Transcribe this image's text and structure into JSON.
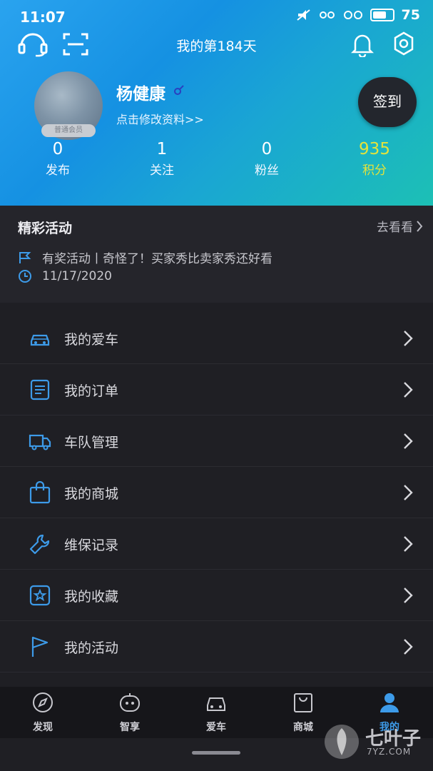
{
  "status_bar": {
    "time": "11:07",
    "battery": "75"
  },
  "header": {
    "title": "我的第184天",
    "user_name": "杨健康",
    "edit_profile": "点击修改资料>>",
    "member_badge": "普通会员",
    "checkin_label": "签到"
  },
  "stats": [
    {
      "value": "0",
      "label": "发布"
    },
    {
      "value": "1",
      "label": "关注"
    },
    {
      "value": "0",
      "label": "粉丝"
    },
    {
      "value": "935",
      "label": "积分"
    }
  ],
  "activity": {
    "title": "精彩活动",
    "more": "去看看",
    "event_text": "有奖活动丨奇怪了！买家秀比卖家秀还好看",
    "event_date": "11/17/2020"
  },
  "menu": [
    {
      "label": "我的爱车",
      "icon": "car-icon"
    },
    {
      "label": "我的订单",
      "icon": "order-icon"
    },
    {
      "label": "车队管理",
      "icon": "truck-icon"
    },
    {
      "label": "我的商城",
      "icon": "shopping-bag-icon"
    },
    {
      "label": "维保记录",
      "icon": "wrench-icon"
    },
    {
      "label": "我的收藏",
      "icon": "star-icon"
    },
    {
      "label": "我的活动",
      "icon": "flag-icon"
    }
  ],
  "tabs": [
    {
      "label": "发现",
      "icon": "compass-icon"
    },
    {
      "label": "智享",
      "icon": "robot-icon"
    },
    {
      "label": "爱车",
      "icon": "car-icon"
    },
    {
      "label": "商城",
      "icon": "bag-icon"
    },
    {
      "label": "我的",
      "icon": "person-icon"
    }
  ],
  "watermark": {
    "brand": "七叶子",
    "domain": "7YZ.COM"
  },
  "colors": {
    "accent": "#3d9be9",
    "points": "#e4e33b",
    "header_start": "#2aa3ef",
    "header_end": "#1cc0b5",
    "background": "#1f1f24"
  }
}
